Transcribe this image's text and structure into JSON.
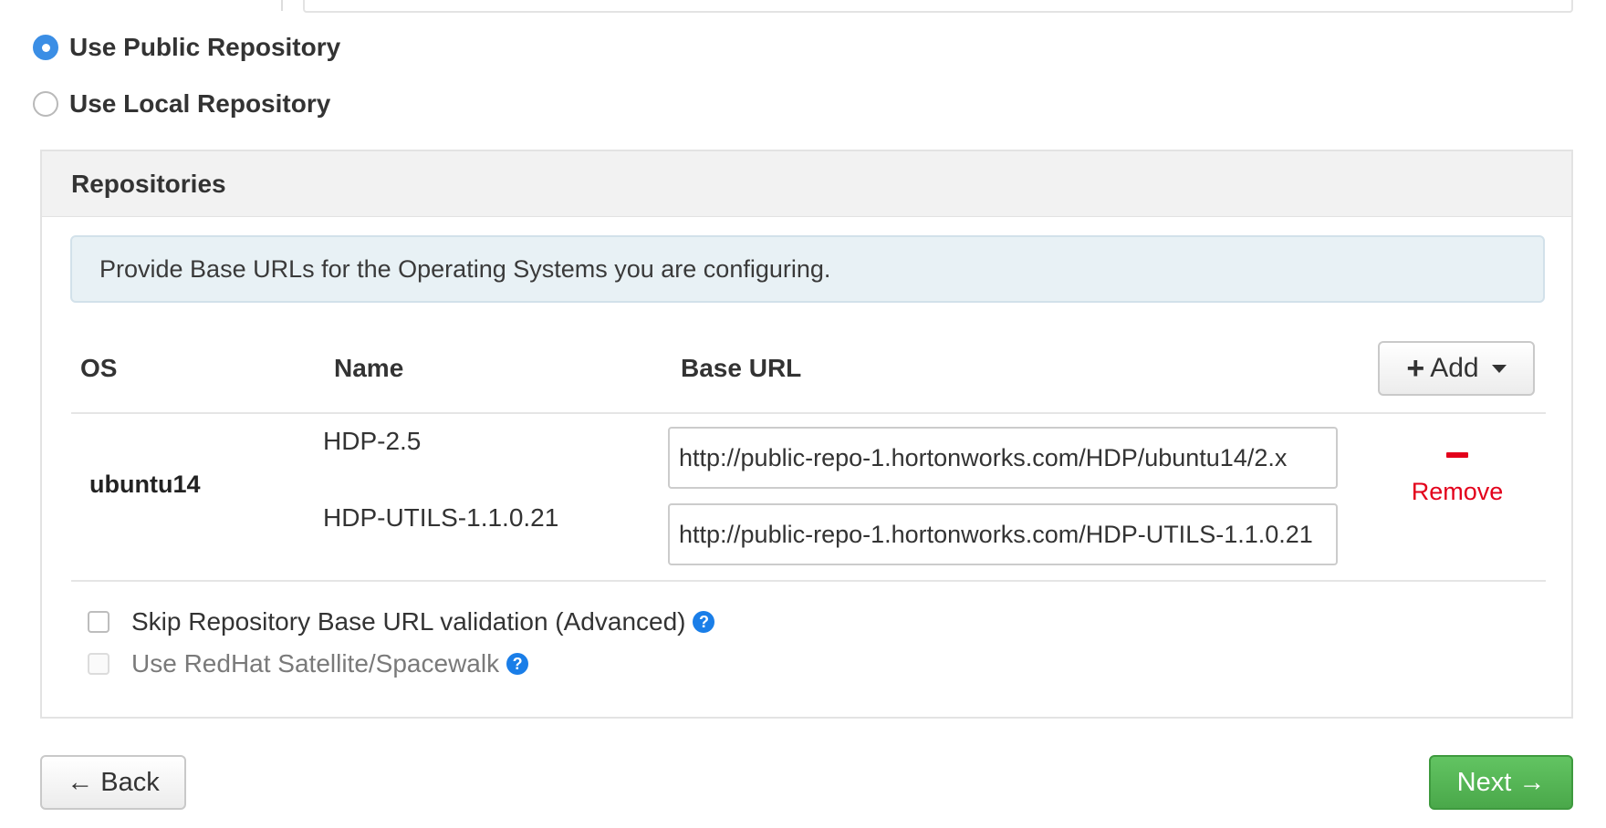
{
  "repo_choice": {
    "public_label": "Use Public Repository",
    "local_label": "Use Local Repository",
    "selected": "public"
  },
  "repositories": {
    "heading": "Repositories",
    "info": "Provide Base URLs for the Operating Systems you are configuring.",
    "columns": {
      "os": "OS",
      "name": "Name",
      "base_url": "Base URL"
    },
    "add_label": "Add",
    "rows": [
      {
        "os": "ubuntu14",
        "repos": [
          {
            "name": "HDP-2.5",
            "base_url": "http://public-repo-1.hortonworks.com/HDP/ubuntu14/2.x"
          },
          {
            "name": "HDP-UTILS-1.1.0.21",
            "base_url": "http://public-repo-1.hortonworks.com/HDP-UTILS-1.1.0.21"
          }
        ],
        "remove_label": "Remove"
      }
    ]
  },
  "options": {
    "skip_validation_label": "Skip Repository Base URL validation (Advanced)",
    "satellite_label": "Use RedHat Satellite/Spacewalk"
  },
  "footer": {
    "back_label": "← Back",
    "next_label": "Next →"
  },
  "colors": {
    "primary_radio": "#3b8ee5",
    "remove": "#e3001b",
    "next": "#5cb85c",
    "help": "#1a7ee8"
  }
}
